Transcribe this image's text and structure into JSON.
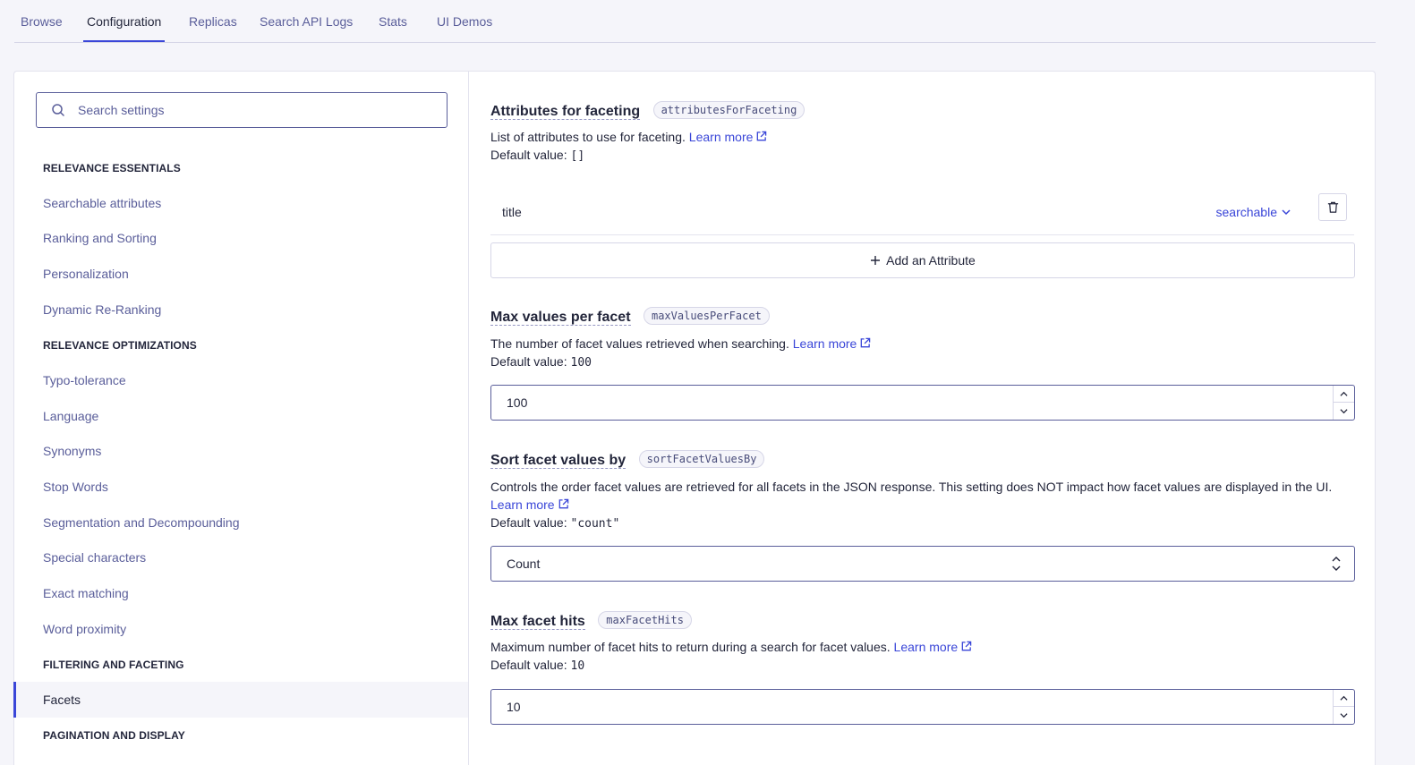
{
  "tabs": [
    {
      "label": "Browse"
    },
    {
      "label": "Configuration"
    },
    {
      "label": "Replicas"
    },
    {
      "label": "Search API Logs"
    },
    {
      "label": "Stats"
    },
    {
      "label": "UI Demos"
    }
  ],
  "search": {
    "placeholder": "Search settings"
  },
  "sidebar": {
    "sections": [
      "RELEVANCE ESSENTIALS",
      "RELEVANCE OPTIMIZATIONS",
      "FILTERING AND FACETING",
      "PAGINATION AND DISPLAY"
    ],
    "items": [
      "Searchable attributes",
      "Ranking and Sorting",
      "Personalization",
      "Dynamic Re-Ranking",
      "Typo-tolerance",
      "Language",
      "Synonyms",
      "Stop Words",
      "Segmentation and Decompounding",
      "Special characters",
      "Exact matching",
      "Word proximity",
      "Facets"
    ]
  },
  "settings": {
    "attributes_for_faceting": {
      "title": "Attributes for faceting",
      "code": "attributesForFaceting",
      "description": "List of attributes to use for faceting.",
      "learn_more": "Learn more",
      "default_label": "Default value:",
      "default_value": "[]",
      "rows": [
        {
          "name": "title",
          "mode": "searchable"
        }
      ],
      "add_label": "Add an Attribute"
    },
    "max_values_per_facet": {
      "title": "Max values per facet",
      "code": "maxValuesPerFacet",
      "description": "The number of facet values retrieved when searching.",
      "learn_more": "Learn more",
      "default_label": "Default value:",
      "default_value": "100",
      "value": "100"
    },
    "sort_facet_values_by": {
      "title": "Sort facet values by",
      "code": "sortFacetValuesBy",
      "description": "Controls the order facet values are retrieved for all facets in the JSON response. This setting does NOT impact how facet values are displayed in the UI.",
      "learn_more": "Learn more",
      "default_label": "Default value:",
      "default_value": "\"count\"",
      "value": "Count"
    },
    "max_facet_hits": {
      "title": "Max facet hits",
      "code": "maxFacetHits",
      "description": "Maximum number of facet hits to return during a search for facet values.",
      "learn_more": "Learn more",
      "default_label": "Default value:",
      "default_value": "10",
      "value": "10"
    }
  },
  "colors": {
    "accent": "#3a46d8",
    "muted_text": "#5a5e9a",
    "text": "#23263b",
    "border": "#d6d6e7"
  }
}
